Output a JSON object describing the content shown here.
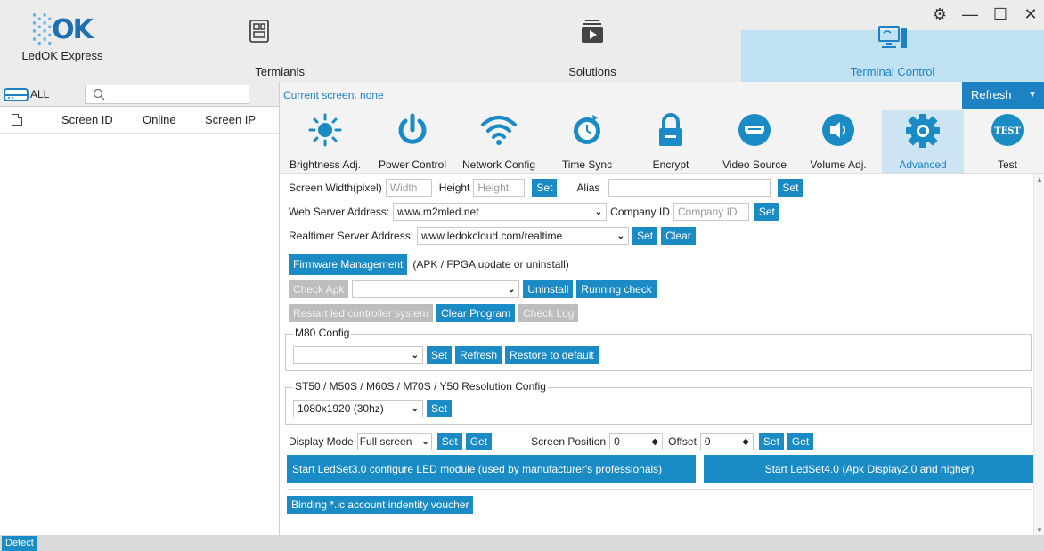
{
  "app": {
    "logo_mark": "OK",
    "name": "LedOK Express"
  },
  "nav": {
    "terminals": "Termianls",
    "solutions": "Solutions",
    "terminal_control": "Terminal Control"
  },
  "left": {
    "all_label": "ALL",
    "search_placeholder": "",
    "columns": [
      "Screen ID",
      "Online",
      "Screen IP"
    ]
  },
  "status": {
    "detect": "Detect"
  },
  "right": {
    "current_screen": "Current screen: none",
    "refresh": "Refresh",
    "tools": [
      {
        "label": "Brightness Adj.",
        "icon": "sun-icon"
      },
      {
        "label": "Power Control",
        "icon": "power-icon"
      },
      {
        "label": "Network Config",
        "icon": "wifi-icon"
      },
      {
        "label": "Time Sync",
        "icon": "clock-sync-icon"
      },
      {
        "label": "Encrypt",
        "icon": "lock-icon"
      },
      {
        "label": "Video Source",
        "icon": "hdmi-icon"
      },
      {
        "label": "Volume Adj.",
        "icon": "speaker-icon"
      },
      {
        "label": "Advanced",
        "icon": "gear-icon"
      },
      {
        "label": "Test",
        "icon": "test-icon"
      }
    ],
    "tool_test_badge": "TEST",
    "form": {
      "screen_width_label": "Screen Width(pixel)",
      "width_placeholder": "Width",
      "height_label": "Height",
      "height_placeholder": "Height",
      "set": "Set",
      "alias_label": "Alias",
      "alias_value": "",
      "web_server_label": "Web Server Address:",
      "web_server_value": "www.m2mled.net",
      "company_id_label": "Company ID",
      "company_id_placeholder": "Company ID",
      "realtimer_label": "Realtimer Server Address:",
      "realtimer_value": "www.ledokcloud.com/realtime",
      "clear": "Clear",
      "firmware_mgmt": "Firmware Management",
      "firmware_note": "(APK / FPGA update or uninstall)",
      "check_apk": "Check Apk",
      "apk_value": "",
      "uninstall": "Uninstall",
      "running_check": "Running check",
      "restart_led": "Restart led controller system",
      "clear_program": "Clear Program",
      "check_log": "Check Log",
      "m80_legend": "M80 Config",
      "m80_value": "",
      "refresh": "Refresh",
      "restore_default": "Restore to default",
      "st50_legend": "ST50 / M50S / M60S / M70S / Y50 Resolution Config",
      "resolution_value": "1080x1920  (30hz)",
      "display_mode_label": "Display Mode",
      "display_mode_value": "Full screen",
      "get": "Get",
      "screen_position_label": "Screen Position",
      "screen_position_value": "0",
      "offset_label": "Offset",
      "offset_value": "0",
      "ledset3": "Start LedSet3.0 configure LED module (used by manufacturer's professionals)",
      "ledset4": "Start LedSet4.0 (Apk Display2.0 and higher)",
      "binding": "Binding *.ic account indentity voucher"
    }
  },
  "colors": {
    "accent": "#1a8bc4",
    "active_tab": "#bfe1f1",
    "disabled": "#bdbdbd"
  }
}
